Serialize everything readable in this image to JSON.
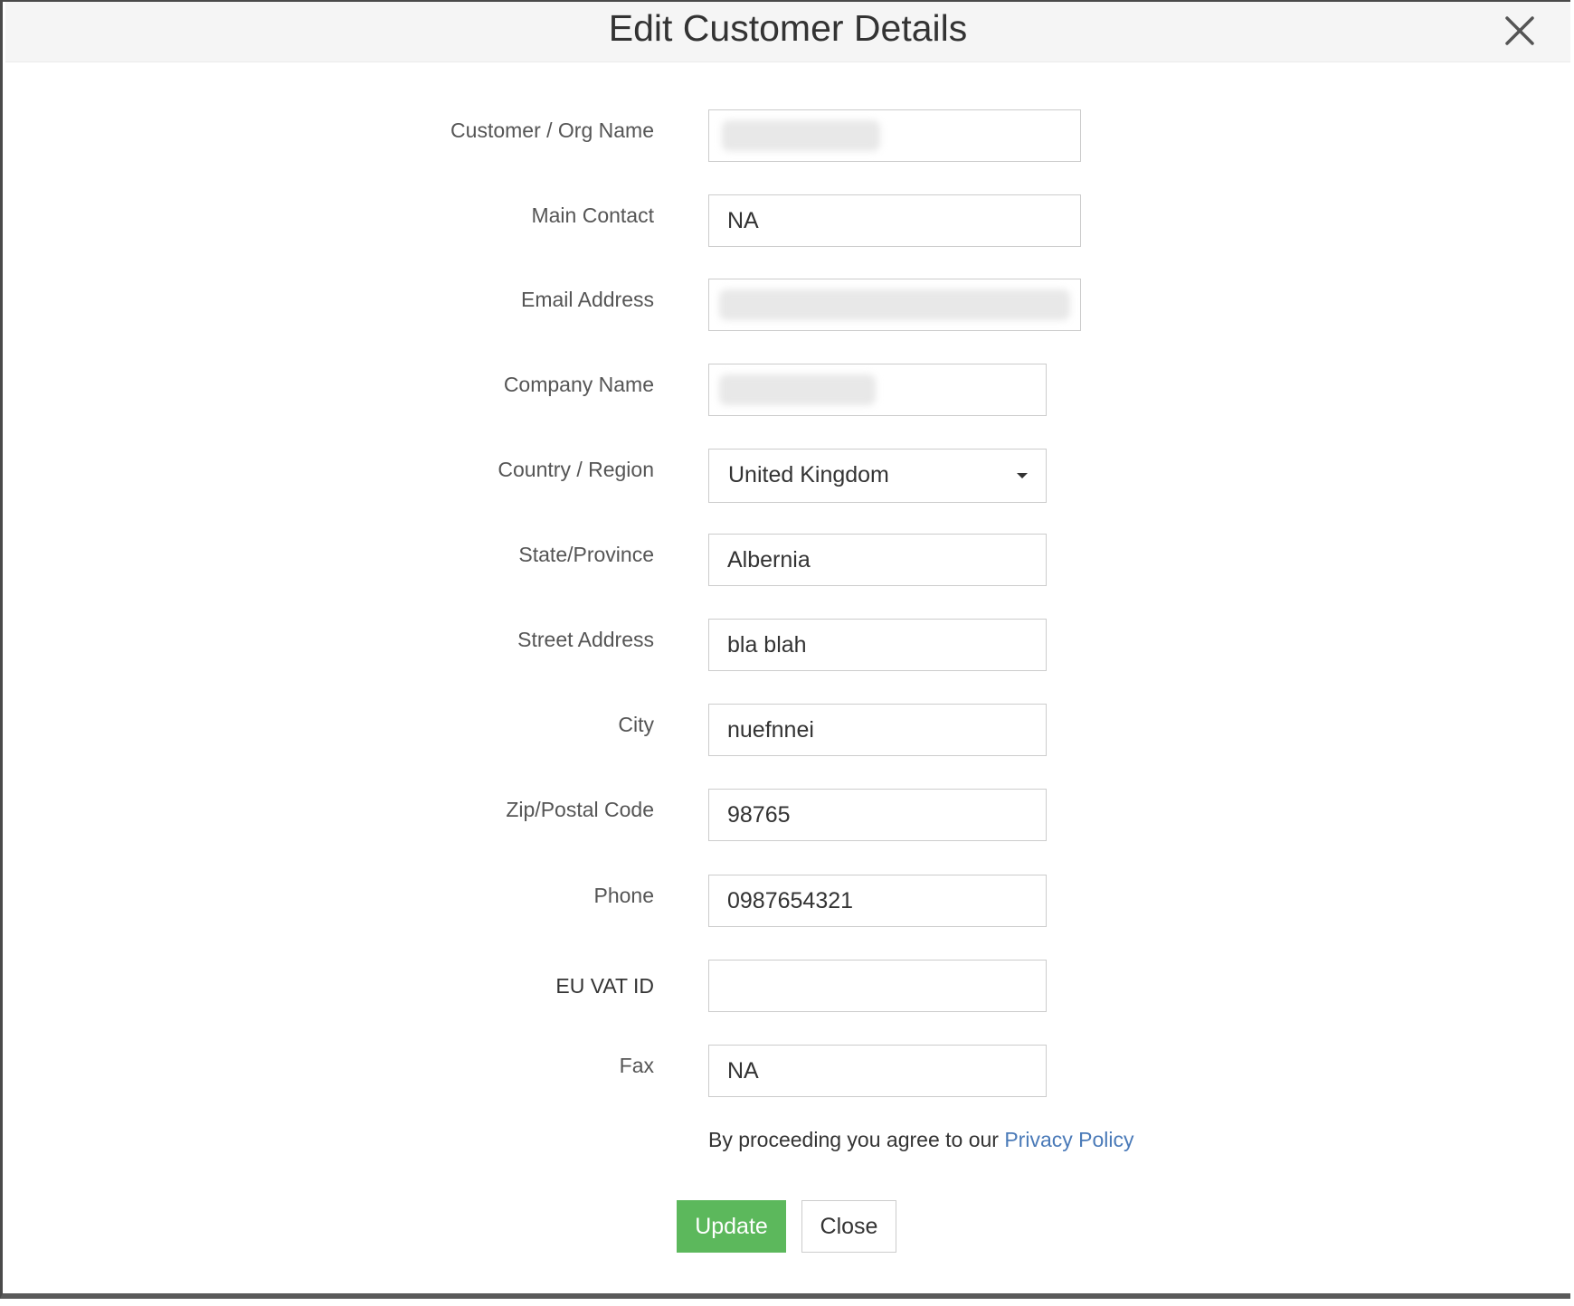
{
  "modal": {
    "title": "Edit Customer Details"
  },
  "fields": {
    "customer_org_name": {
      "label": "Customer / Org Name",
      "value": ""
    },
    "main_contact": {
      "label": "Main Contact",
      "value": "NA"
    },
    "email_address": {
      "label": "Email Address",
      "value": ""
    },
    "company_name": {
      "label": "Company Name",
      "value": ""
    },
    "country_region": {
      "label": "Country / Region",
      "value": "United Kingdom"
    },
    "state_province": {
      "label": "State/Province",
      "value": "Albernia"
    },
    "street_address": {
      "label": "Street Address",
      "value": "bla blah"
    },
    "city": {
      "label": "City",
      "value": "nuefnnei"
    },
    "zip_postal_code": {
      "label": "Zip/Postal Code",
      "value": "98765"
    },
    "phone": {
      "label": "Phone",
      "value": "0987654321"
    },
    "eu_vat_id": {
      "label": "EU VAT ID",
      "value": ""
    },
    "fax": {
      "label": "Fax",
      "value": "NA"
    }
  },
  "privacy": {
    "text": "By proceeding you agree to our ",
    "link_label": "Privacy Policy"
  },
  "buttons": {
    "update_label": "Update",
    "close_label": "Close"
  },
  "icons": {
    "close": "close-icon",
    "dropdown": "caret-down-icon"
  },
  "colors": {
    "update_button": "#5cb85c",
    "link": "#4a7ab8",
    "header_bg": "#f5f5f5"
  }
}
